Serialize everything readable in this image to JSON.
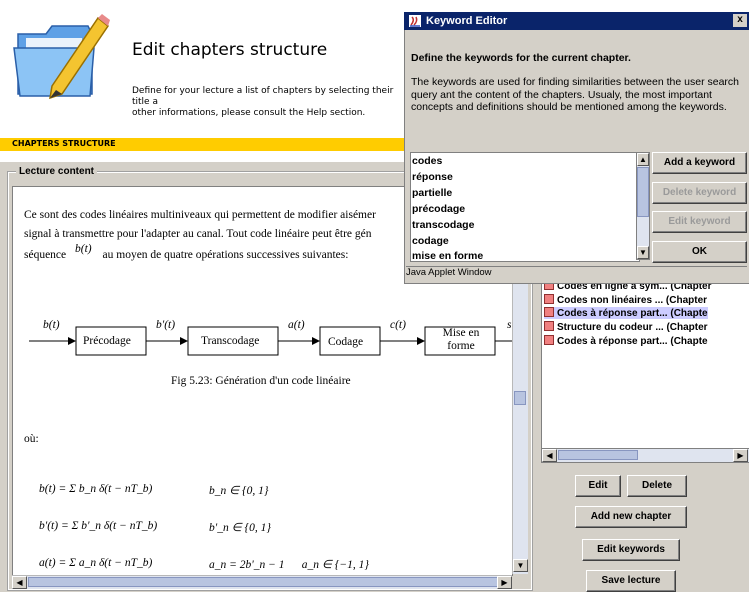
{
  "header": {
    "title": "Edit chapters structure",
    "description_line1": "Define for your lecture a list of chapters by selecting their title a",
    "description_line2": "other informations, please consult the Help section.",
    "section_bar": "CHAPTERS STRUCTURE"
  },
  "lecture": {
    "panel_title": "Lecture content",
    "para_line1": "Ce sont des codes linéaires multiniveaux qui permettent de modifier aisémer",
    "para_line2": "signal à transmettre pour l'adapter au canal. Tout code linéaire peut être gén",
    "para_line3_prefix": "séquence",
    "para_line3_math": "b(t)",
    "para_line3_suffix": "au moyen de quatre opérations successives suivantes:",
    "diagram": {
      "input_label": "b(t)",
      "blocks": [
        "Précodage",
        "Transcodage",
        "Codage",
        "Mise en forme"
      ],
      "arrow_labels": [
        "b'(t)",
        "a(t)",
        "c(t)",
        "s"
      ]
    },
    "fig_caption": "Fig 5.23: Génération d'un code linéaire",
    "ou": "où:",
    "equations": [
      {
        "lhs": "b(t) = Σ b_n δ(t − nT_b)",
        "rhs": "b_n ∈ {0, 1}"
      },
      {
        "lhs": "b'(t) = Σ b'_n δ(t − nT_b)",
        "rhs": "b'_n ∈ {0, 1}"
      },
      {
        "lhs": "a(t) = Σ a_n δ(t − nT_b)",
        "rhs": "a_n = 2b'_n − 1      a_n ∈ {−1, 1}"
      }
    ]
  },
  "chapters": {
    "items": [
      {
        "label": "Codes en ligne à sym... (Chapter",
        "selected": false
      },
      {
        "label": "Codes non linéaires ... (Chapter",
        "selected": false
      },
      {
        "label": "Codes à réponse part... (Chapte",
        "selected": true
      },
      {
        "label": "Structure du codeur ... (Chapter",
        "selected": false
      },
      {
        "label": "Codes à réponse part... (Chapte",
        "selected": false
      }
    ],
    "buttons": {
      "edit": "Edit",
      "delete": "Delete",
      "add": "Add new chapter",
      "edit_keywords": "Edit keywords",
      "save": "Save lecture"
    }
  },
  "keyword_editor": {
    "title": "Keyword Editor",
    "close": "x",
    "heading": "Define the keywords for the current chapter.",
    "text": "The keywords are used for finding similarities between the user search query ant the content of the chapters. Usualy, the most important concepts and definitions should be mentioned among the keywords.",
    "keywords": [
      "codes",
      "réponse",
      "partielle",
      "précodage",
      "transcodage",
      "codage",
      "mise en forme"
    ],
    "buttons": {
      "add": "Add a keyword",
      "delete": "Delete keyword",
      "edit": "Edit keyword",
      "ok": "OK"
    },
    "status": "Java Applet Window"
  },
  "colors": {
    "section_bar": "#FFCC00",
    "title_bar": "#0a246a",
    "chapter_icon": "#f08080",
    "selection": "#ccccff"
  }
}
